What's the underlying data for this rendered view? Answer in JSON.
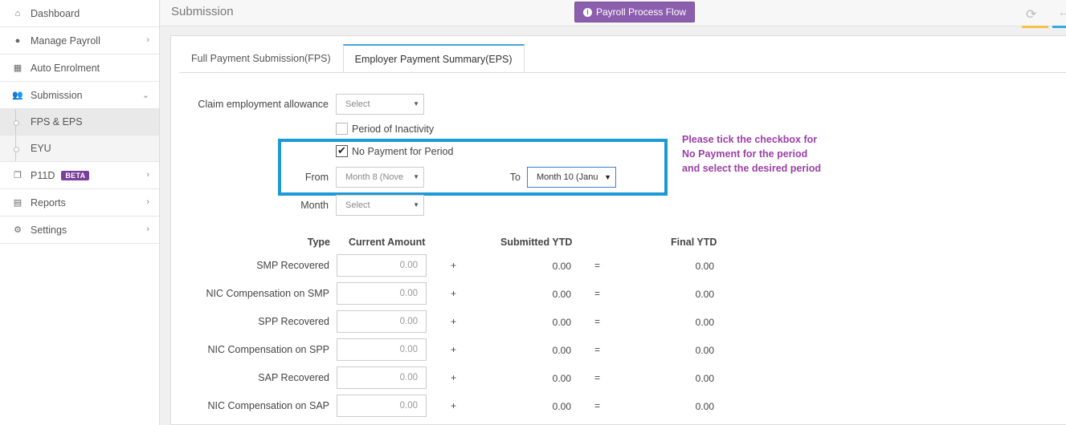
{
  "sidebar": {
    "items": [
      {
        "label": "Dashboard",
        "icon": "home-icon",
        "chevron": false
      },
      {
        "label": "Manage Payroll",
        "icon": "user-icon",
        "chevron": true
      },
      {
        "label": "Auto Enrolment",
        "icon": "grid-icon",
        "chevron": false
      },
      {
        "label": "Submission",
        "icon": "users-icon",
        "chevron": true,
        "expanded": true
      },
      {
        "label": "FPS & EPS",
        "sub": true,
        "active": true
      },
      {
        "label": "EYU",
        "sub": true
      },
      {
        "label": "P11D",
        "icon": "copy-icon",
        "chevron": true,
        "badge": "BETA"
      },
      {
        "label": "Reports",
        "icon": "report-icon",
        "chevron": true
      },
      {
        "label": "Settings",
        "icon": "gear-icon",
        "chevron": true
      }
    ]
  },
  "header": {
    "title": "Submission",
    "flow_button": "Payroll Process Flow"
  },
  "tabs": [
    {
      "label": "Full Payment Submission(FPS)",
      "active": false
    },
    {
      "label": "Employer Payment Summary(EPS)",
      "active": true
    }
  ],
  "form": {
    "claim_label": "Claim employment allowance",
    "claim_value": "Select",
    "inactivity_label": "Period of Inactivity",
    "inactivity_checked": false,
    "no_payment_label": "No Payment for Period",
    "no_payment_checked": true,
    "from_label": "From",
    "from_value": "Month 8 (Nove",
    "to_label": "To",
    "to_value": "Month 10 (Janu",
    "month_label": "Month",
    "month_value": "Select"
  },
  "note": {
    "line1": "Please tick the checkbox for",
    "line2": "No Payment for the period",
    "line3": "and select the desired period"
  },
  "table": {
    "headers": {
      "type": "Type",
      "current": "Current Amount",
      "submitted": "Submitted YTD",
      "final": "Final YTD"
    },
    "rows": [
      {
        "type": "SMP Recovered",
        "current": "0.00",
        "plus": "+",
        "submitted": "0.00",
        "eq": "=",
        "final": "0.00"
      },
      {
        "type": "NIC Compensation on SMP",
        "current": "0.00",
        "plus": "+",
        "submitted": "0.00",
        "eq": "=",
        "final": "0.00"
      },
      {
        "type": "SPP Recovered",
        "current": "0.00",
        "plus": "+",
        "submitted": "0.00",
        "eq": "=",
        "final": "0.00"
      },
      {
        "type": "NIC Compensation on SPP",
        "current": "0.00",
        "plus": "+",
        "submitted": "0.00",
        "eq": "=",
        "final": "0.00"
      },
      {
        "type": "SAP Recovered",
        "current": "0.00",
        "plus": "+",
        "submitted": "0.00",
        "eq": "=",
        "final": "0.00"
      },
      {
        "type": "NIC Compensation on SAP",
        "current": "0.00",
        "plus": "+",
        "submitted": "0.00",
        "eq": "=",
        "final": "0.00"
      }
    ]
  },
  "colors": {
    "accent": "#8c5fae",
    "highlight": "#1b9ad6",
    "note": "#9b3fa6"
  }
}
